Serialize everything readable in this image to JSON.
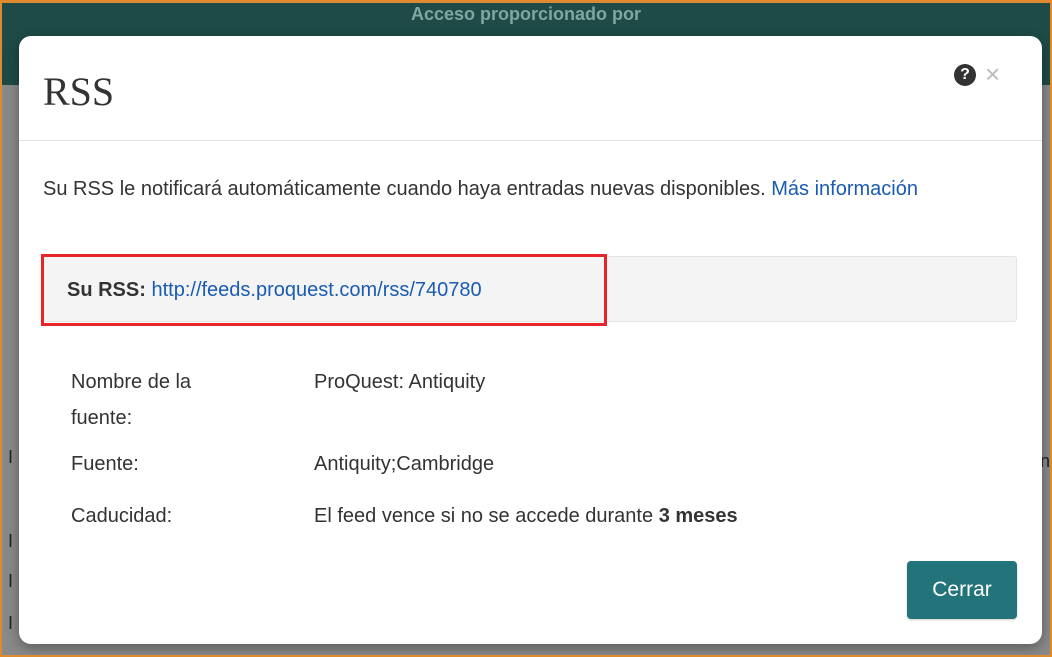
{
  "backdrop": {
    "header_text": "Acceso proporcionado por"
  },
  "modal": {
    "title": "RSS",
    "help_icon": "question-circle-icon",
    "help_glyph": "?",
    "close_icon": "close-icon",
    "close_glyph": "×",
    "intro_text": "Su RSS le notificará automáticamente cuando haya entradas nuevas disponibles.",
    "more_info_link": "Más información",
    "rss_label": "Su RSS:",
    "rss_url": "http://feeds.proquest.com/rss/740780",
    "details": {
      "source_name_label": "Nombre de la fuente:",
      "source_name_value": "ProQuest: Antiquity",
      "source_label": "Fuente:",
      "source_value": "Antiquity;Cambridge",
      "expiration_label": "Caducidad:",
      "expiration_value_prefix": "El feed vence si no se accede durante",
      "expiration_value_bold": "3 meses"
    },
    "close_button": "Cerrar"
  },
  "colors": {
    "header_bg": "#1e4b47",
    "link": "#1a5bb3",
    "button_bg": "#23747a",
    "highlight_border": "#e8232a",
    "frame_border": "#e08a2e"
  }
}
